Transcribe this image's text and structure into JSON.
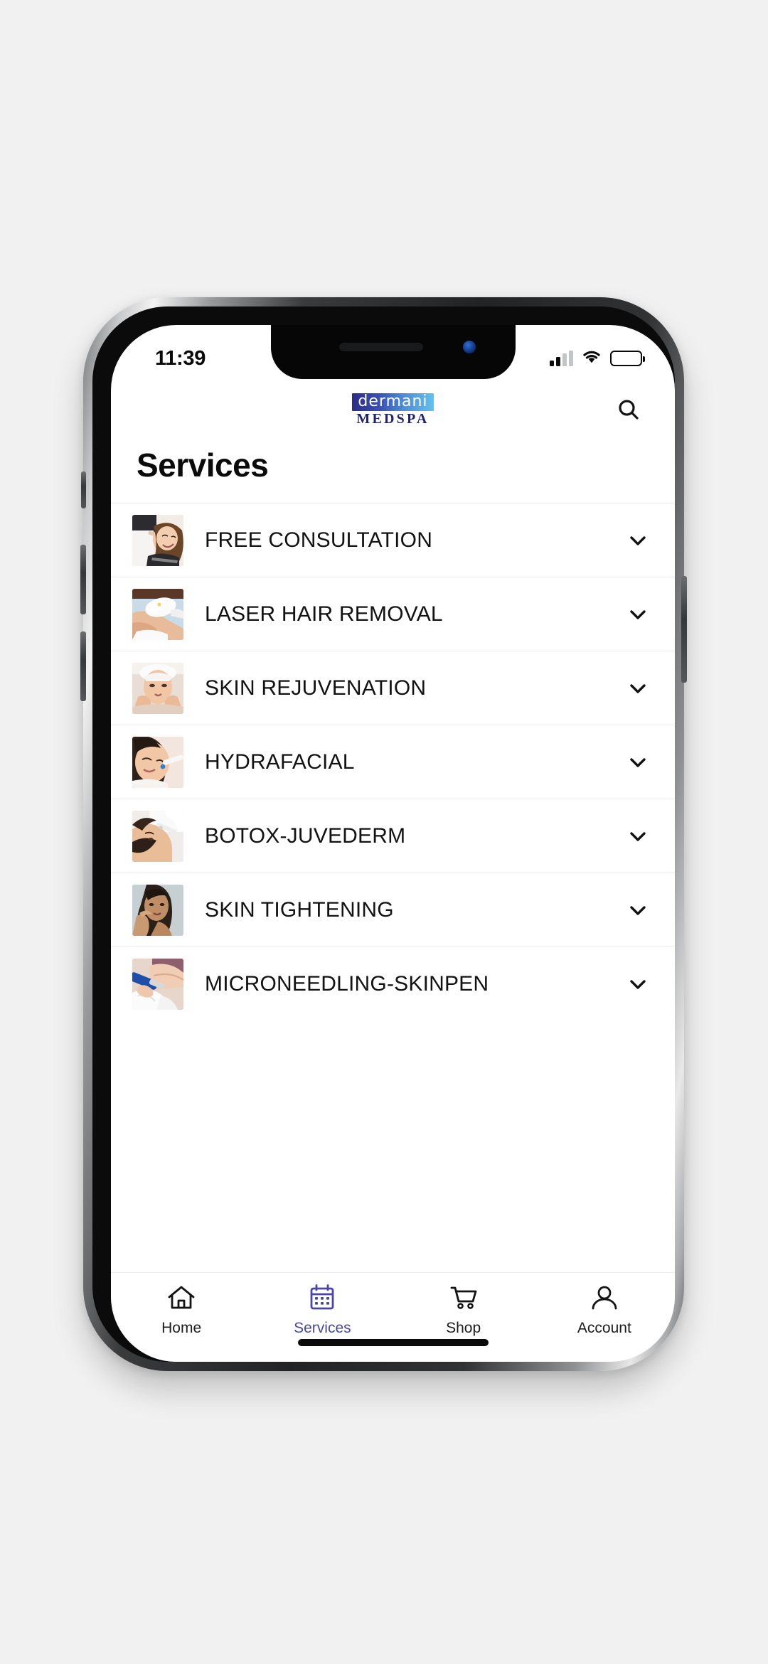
{
  "status_bar": {
    "time": "11:39",
    "signal_icon": "cellular-signal-icon",
    "signal_bars_filled": 2,
    "signal_bars_total": 4,
    "wifi_icon": "wifi-icon",
    "battery_icon": "battery-icon",
    "battery_color": "#f9c515"
  },
  "header": {
    "logo_primary": "dermani",
    "logo_secondary": "MEDSPA",
    "logo_gradient_from": "#2b2c86",
    "logo_gradient_to": "#63c2ec",
    "search_icon": "search-icon"
  },
  "page": {
    "title": "Services"
  },
  "services": [
    {
      "label": "FREE CONSULTATION",
      "chevron": "chevron-down-icon",
      "thumb": "woman-receiving-consultation-photo"
    },
    {
      "label": "LASER HAIR REMOVAL",
      "chevron": "chevron-down-icon",
      "thumb": "laser-device-on-leg-photo"
    },
    {
      "label": "SKIN REJUVENATION",
      "chevron": "chevron-down-icon",
      "thumb": "woman-facial-treatment-photo"
    },
    {
      "label": "HYDRAFACIAL",
      "chevron": "chevron-down-icon",
      "thumb": "hydrafacial-wand-on-cheek-photo"
    },
    {
      "label": "BOTOX-JUVEDERM",
      "chevron": "chevron-down-icon",
      "thumb": "forehead-injection-photo"
    },
    {
      "label": "SKIN TIGHTENING",
      "chevron": "chevron-down-icon",
      "thumb": "woman-touching-face-photo"
    },
    {
      "label": "MICRONEEDLING-SKINPEN",
      "chevron": "chevron-down-icon",
      "thumb": "microneedling-pen-photo"
    }
  ],
  "bottom_nav": {
    "active_color": "#4a47a3",
    "inactive_color": "#1c1c1c",
    "items": [
      {
        "label": "Home",
        "icon": "home-icon",
        "active": false
      },
      {
        "label": "Services",
        "icon": "calendar-icon",
        "active": true
      },
      {
        "label": "Shop",
        "icon": "cart-icon",
        "active": false
      },
      {
        "label": "Account",
        "icon": "person-icon",
        "active": false
      }
    ]
  }
}
